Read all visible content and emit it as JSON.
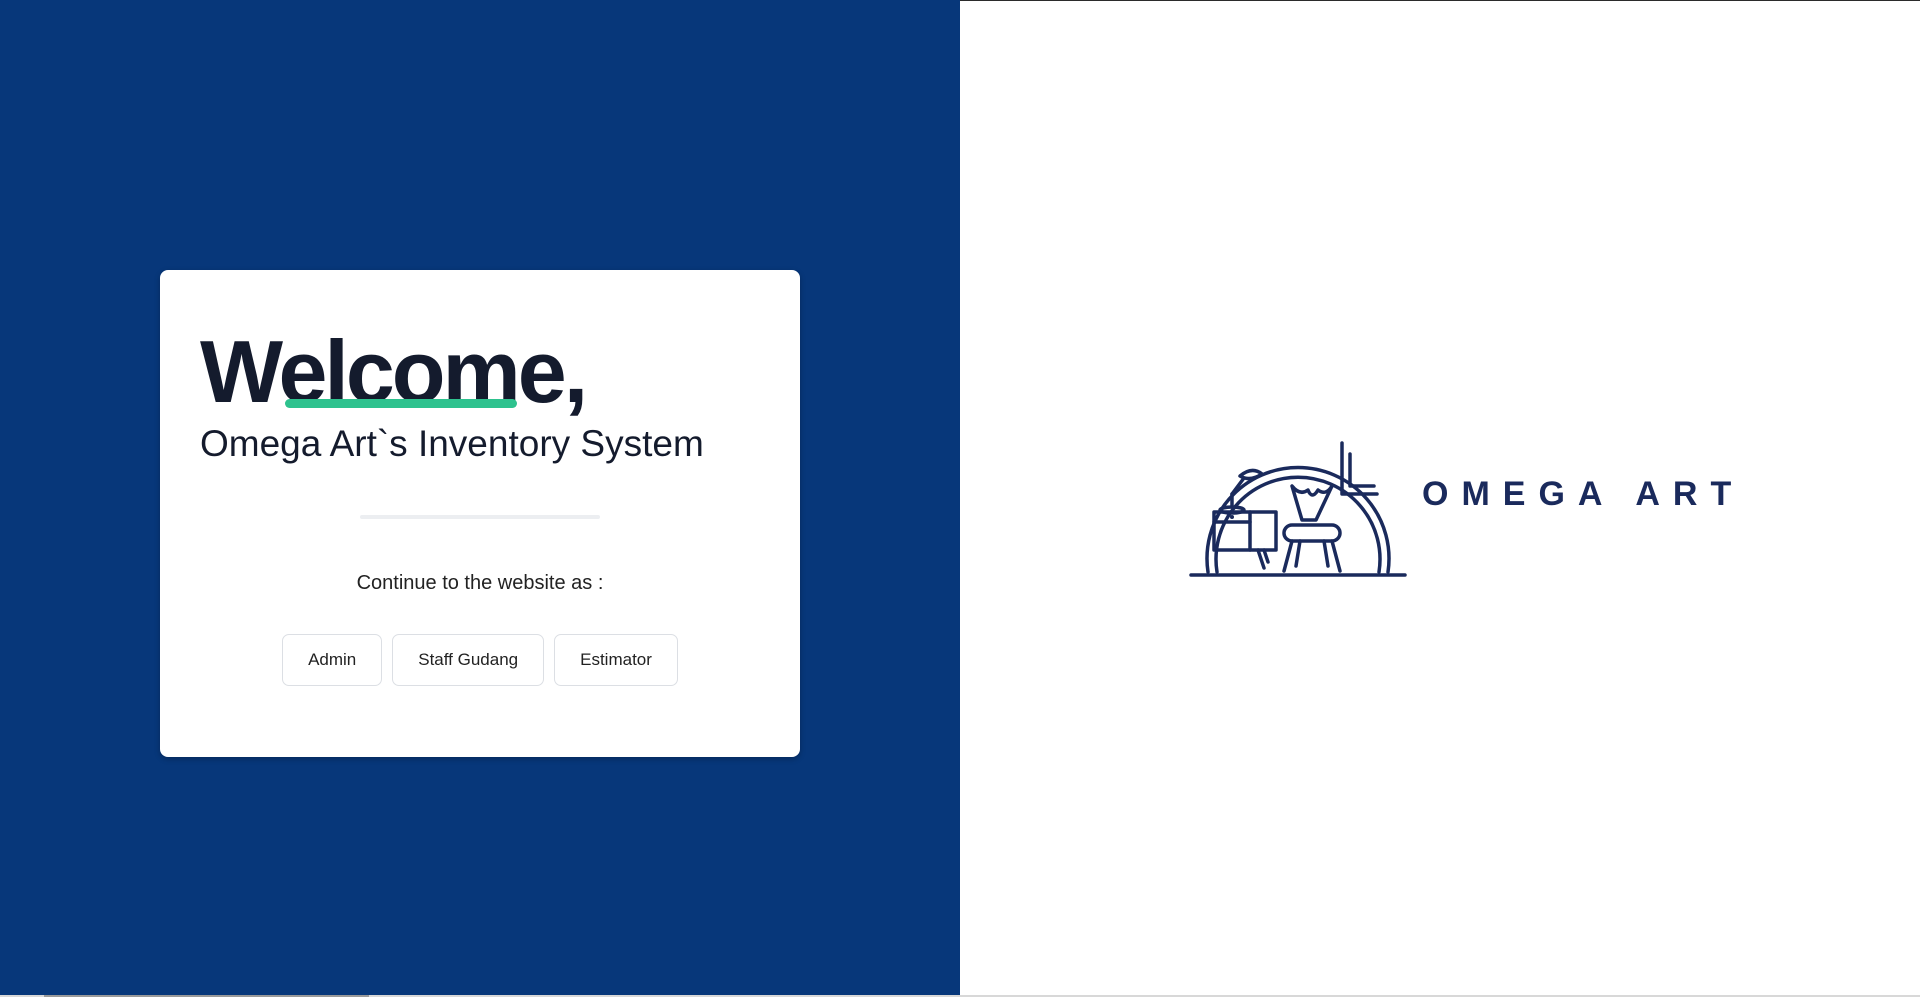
{
  "colors": {
    "left_panel_bg": "#07377a",
    "accent": "#2ec28e",
    "brand": "#1a2a5c"
  },
  "welcome_card": {
    "heading": "Welcome,",
    "system_title": "Omega Art`s Inventory System",
    "continue_prompt": "Continue to the website as :",
    "roles": [
      {
        "label": "Admin"
      },
      {
        "label": "Staff Gudang"
      },
      {
        "label": "Estimator"
      }
    ]
  },
  "logo": {
    "icon": "interior-furniture-icon",
    "brand_name": "OMEGA ART"
  }
}
